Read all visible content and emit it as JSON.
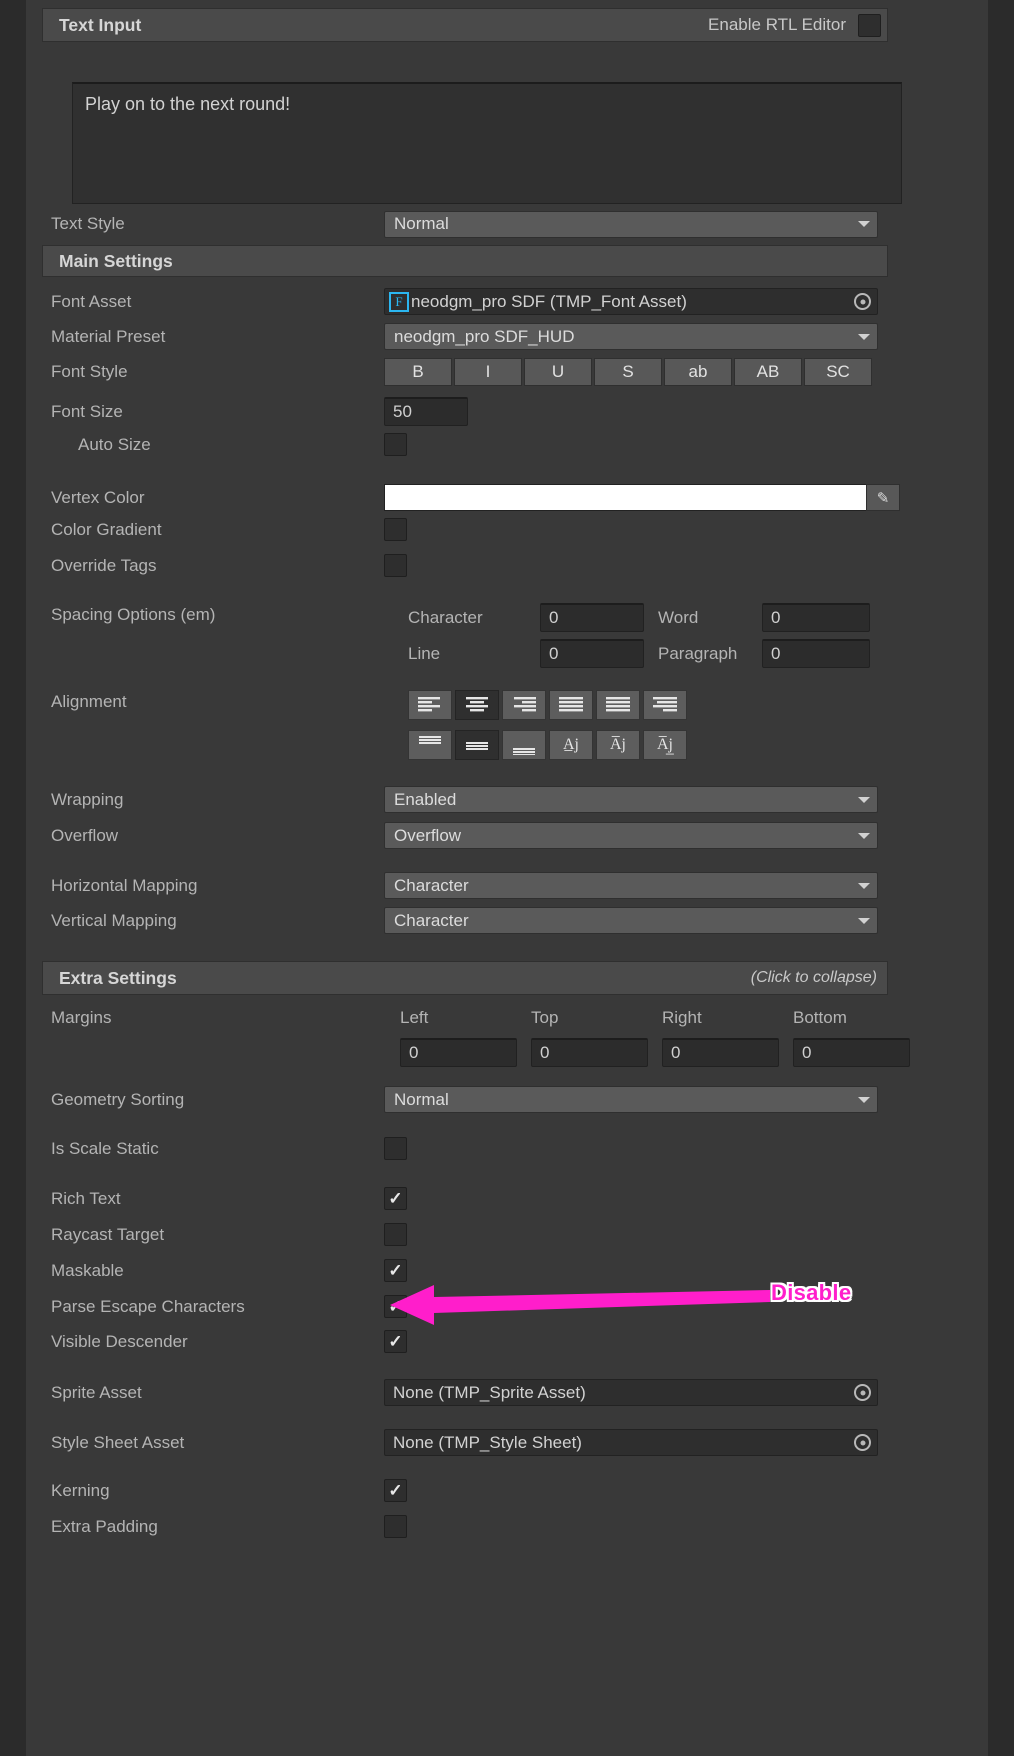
{
  "header": {
    "text_input_title": "Text Input",
    "rtl_label": "Enable RTL Editor",
    "rtl_checked": false
  },
  "text_area": {
    "value": "Play on to the next round!"
  },
  "text_style": {
    "label": "Text Style",
    "value": "Normal"
  },
  "main_settings": {
    "title": "Main Settings",
    "font_asset": {
      "label": "Font Asset",
      "value": "neodgm_pro SDF (TMP_Font Asset)",
      "icon": "font-asset-icon"
    },
    "material_preset": {
      "label": "Material Preset",
      "value": "neodgm_pro SDF_HUD"
    },
    "font_style": {
      "label": "Font Style",
      "buttons": [
        "B",
        "I",
        "U",
        "S",
        "ab",
        "AB",
        "SC"
      ]
    },
    "font_size": {
      "label": "Font Size",
      "value": "50"
    },
    "auto_size": {
      "label": "Auto Size",
      "checked": false
    },
    "vertex_color": {
      "label": "Vertex Color",
      "color": "#ffffff"
    },
    "color_gradient": {
      "label": "Color Gradient",
      "checked": false
    },
    "override_tags": {
      "label": "Override Tags",
      "checked": false
    },
    "spacing": {
      "label": "Spacing Options (em)",
      "character": {
        "label": "Character",
        "value": "0"
      },
      "word": {
        "label": "Word",
        "value": "0"
      },
      "line": {
        "label": "Line",
        "value": "0"
      },
      "paragraph": {
        "label": "Paragraph",
        "value": "0"
      }
    },
    "alignment": {
      "label": "Alignment",
      "horizontal_selected": 1,
      "vertical_selected": 1,
      "horizontal_options": [
        "align-left",
        "align-center",
        "align-right",
        "align-justified",
        "align-flush",
        "align-geometry-center"
      ],
      "vertical_options": [
        "align-top",
        "align-middle",
        "align-bottom",
        "align-baseline",
        "align-midline",
        "align-capline"
      ]
    },
    "wrapping": {
      "label": "Wrapping",
      "value": "Enabled"
    },
    "overflow": {
      "label": "Overflow",
      "value": "Overflow"
    },
    "horizontal_mapping": {
      "label": "Horizontal Mapping",
      "value": "Character"
    },
    "vertical_mapping": {
      "label": "Vertical Mapping",
      "value": "Character"
    }
  },
  "extra_settings": {
    "title": "Extra Settings",
    "collapse_hint": "(Click to collapse)",
    "margins": {
      "label": "Margins",
      "fields": [
        {
          "label": "Left",
          "value": "0"
        },
        {
          "label": "Top",
          "value": "0"
        },
        {
          "label": "Right",
          "value": "0"
        },
        {
          "label": "Bottom",
          "value": "0"
        }
      ]
    },
    "geometry_sorting": {
      "label": "Geometry Sorting",
      "value": "Normal"
    },
    "is_scale_static": {
      "label": "Is Scale Static",
      "checked": false
    },
    "rich_text": {
      "label": "Rich Text",
      "checked": true
    },
    "raycast_target": {
      "label": "Raycast Target",
      "checked": false
    },
    "maskable": {
      "label": "Maskable",
      "checked": true
    },
    "parse_escape_characters": {
      "label": "Parse Escape Characters",
      "checked": true
    },
    "visible_descender": {
      "label": "Visible Descender",
      "checked": true
    },
    "sprite_asset": {
      "label": "Sprite Asset",
      "value": "None (TMP_Sprite Asset)"
    },
    "style_sheet_asset": {
      "label": "Style Sheet Asset",
      "value": "None (TMP_Style Sheet)"
    },
    "kerning": {
      "label": "Kerning",
      "checked": true
    },
    "extra_padding": {
      "label": "Extra Padding",
      "checked": false
    }
  },
  "annotation": {
    "text": "Disable",
    "color": "#ff1ecb"
  }
}
